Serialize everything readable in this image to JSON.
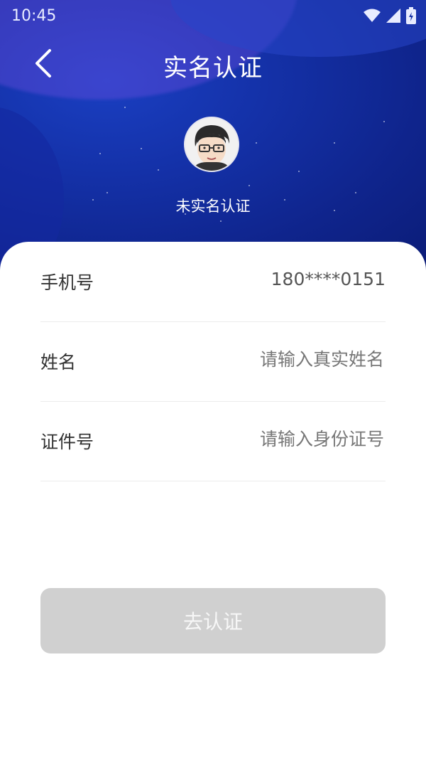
{
  "status_bar": {
    "time": "10:45"
  },
  "header": {
    "title": "实名认证"
  },
  "profile": {
    "verification_status": "未实名认证"
  },
  "form": {
    "phone": {
      "label": "手机号",
      "value": "180****0151"
    },
    "name": {
      "label": "姓名",
      "placeholder": "请输入真实姓名"
    },
    "id_number": {
      "label": "证件号",
      "placeholder": "请输入身份证号"
    }
  },
  "submit_label": "去认证"
}
